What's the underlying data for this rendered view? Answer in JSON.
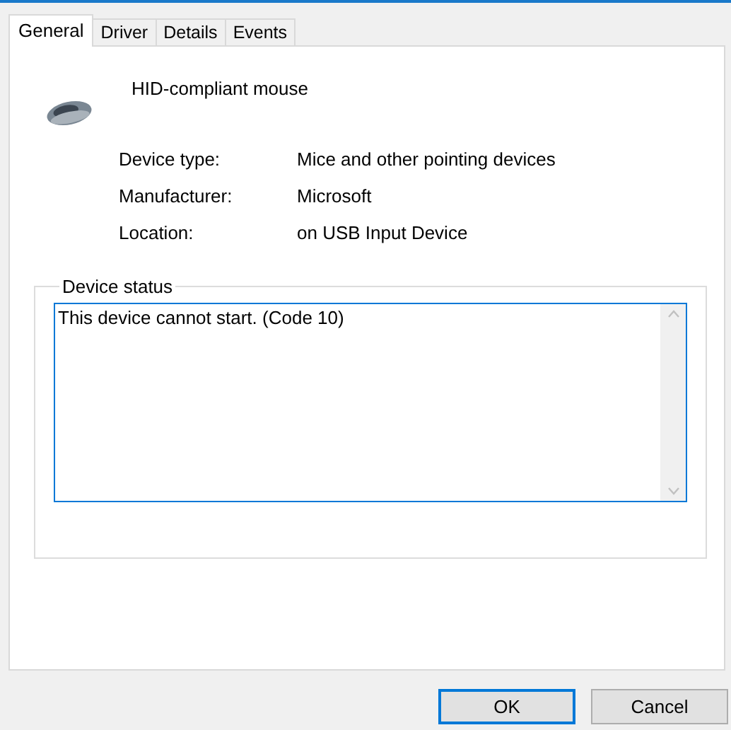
{
  "tabs": [
    {
      "label": "General",
      "selected": true
    },
    {
      "label": "Driver",
      "selected": false
    },
    {
      "label": "Details",
      "selected": false
    },
    {
      "label": "Events",
      "selected": false
    }
  ],
  "device": {
    "name": "HID-compliant mouse"
  },
  "properties": [
    {
      "label": "Device type:",
      "value": "Mice and other pointing devices"
    },
    {
      "label": "Manufacturer:",
      "value": "Microsoft"
    },
    {
      "label": "Location:",
      "value": "on USB Input Device"
    }
  ],
  "device_status": {
    "title": "Device status",
    "value": "This device cannot start. (Code 10)"
  },
  "buttons": [
    {
      "label": "OK",
      "default": true
    },
    {
      "label": "Cancel",
      "default": false
    }
  ]
}
